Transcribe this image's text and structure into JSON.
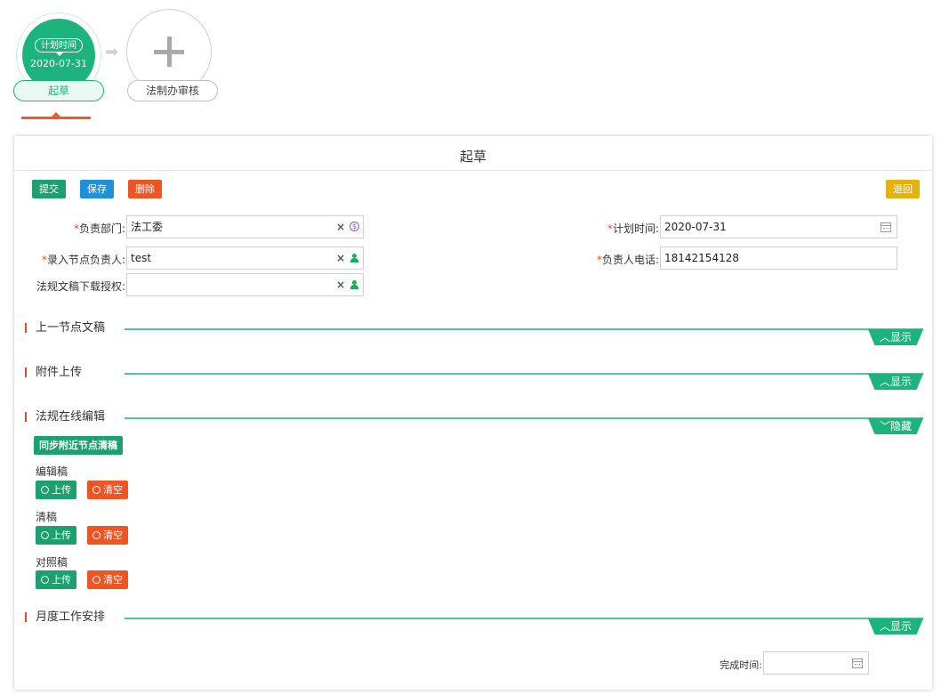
{
  "workflow": {
    "active_node": {
      "badge": "计划时间",
      "date": "2020-07-31",
      "label": "起草"
    },
    "next_node": {
      "label": "法制办审核"
    }
  },
  "panel": {
    "title": "起草",
    "toolbar": {
      "submit": "提交",
      "save": "保存",
      "delete": "删除",
      "back": "退回"
    },
    "fields": {
      "department": {
        "label": "负责部门:",
        "value": "法工委",
        "required": true
      },
      "plan_time": {
        "label": "计划时间:",
        "value": "2020-07-31",
        "required": true
      },
      "node_owner": {
        "label": "录入节点负责人:",
        "value": "test",
        "required": true
      },
      "owner_phone": {
        "label": "负责人电话:",
        "value": "18142154128",
        "required": true
      },
      "download_auth": {
        "label": "法规文稿下载授权:",
        "value": "",
        "required": false
      }
    },
    "sections": [
      {
        "title": "上一节点文稿",
        "toggle": "显示",
        "expanded": false
      },
      {
        "title": "附件上传",
        "toggle": "显示",
        "expanded": false
      },
      {
        "title": "法规在线编辑",
        "toggle": "隐藏",
        "expanded": true
      },
      {
        "title": "月度工作安排",
        "toggle": "显示",
        "expanded": false
      }
    ],
    "online_edit": {
      "sync_button": "同步附近节点清稿",
      "groups": [
        {
          "label": "编辑稿",
          "upload": "上传",
          "clear": "清空"
        },
        {
          "label": "清稿",
          "upload": "上传",
          "clear": "清空"
        },
        {
          "label": "对照稿",
          "upload": "上传",
          "clear": "清空"
        }
      ]
    },
    "monthly": {
      "finish_time_label": "完成时间:",
      "finish_time_value": ""
    }
  },
  "colors": {
    "green": "#1db37c",
    "red": "#ef5423",
    "blue": "#1e90dc",
    "yellow": "#e5b10d"
  }
}
